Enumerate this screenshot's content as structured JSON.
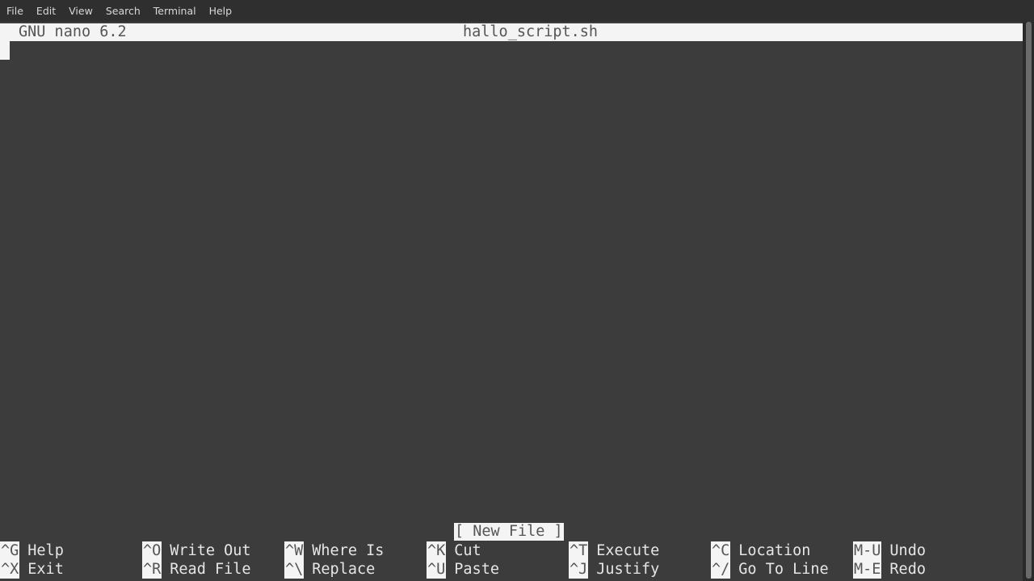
{
  "menubar": {
    "items": [
      "File",
      "Edit",
      "View",
      "Search",
      "Terminal",
      "Help"
    ]
  },
  "nano": {
    "version": "GNU nano 6.2",
    "filename": "hallo_script.sh",
    "status": "[ New File ]",
    "shortcuts": [
      {
        "key": "^G",
        "label": "Help"
      },
      {
        "key": "^X",
        "label": "Exit"
      },
      {
        "key": "^O",
        "label": "Write Out"
      },
      {
        "key": "^R",
        "label": "Read File"
      },
      {
        "key": "^W",
        "label": "Where Is"
      },
      {
        "key": "^\\",
        "label": "Replace"
      },
      {
        "key": "^K",
        "label": "Cut"
      },
      {
        "key": "^U",
        "label": "Paste"
      },
      {
        "key": "^T",
        "label": "Execute"
      },
      {
        "key": "^J",
        "label": "Justify"
      },
      {
        "key": "^C",
        "label": "Location"
      },
      {
        "key": "^/",
        "label": "Go To Line"
      },
      {
        "key": "M-U",
        "label": "Undo"
      },
      {
        "key": "M-E",
        "label": "Redo"
      }
    ]
  }
}
